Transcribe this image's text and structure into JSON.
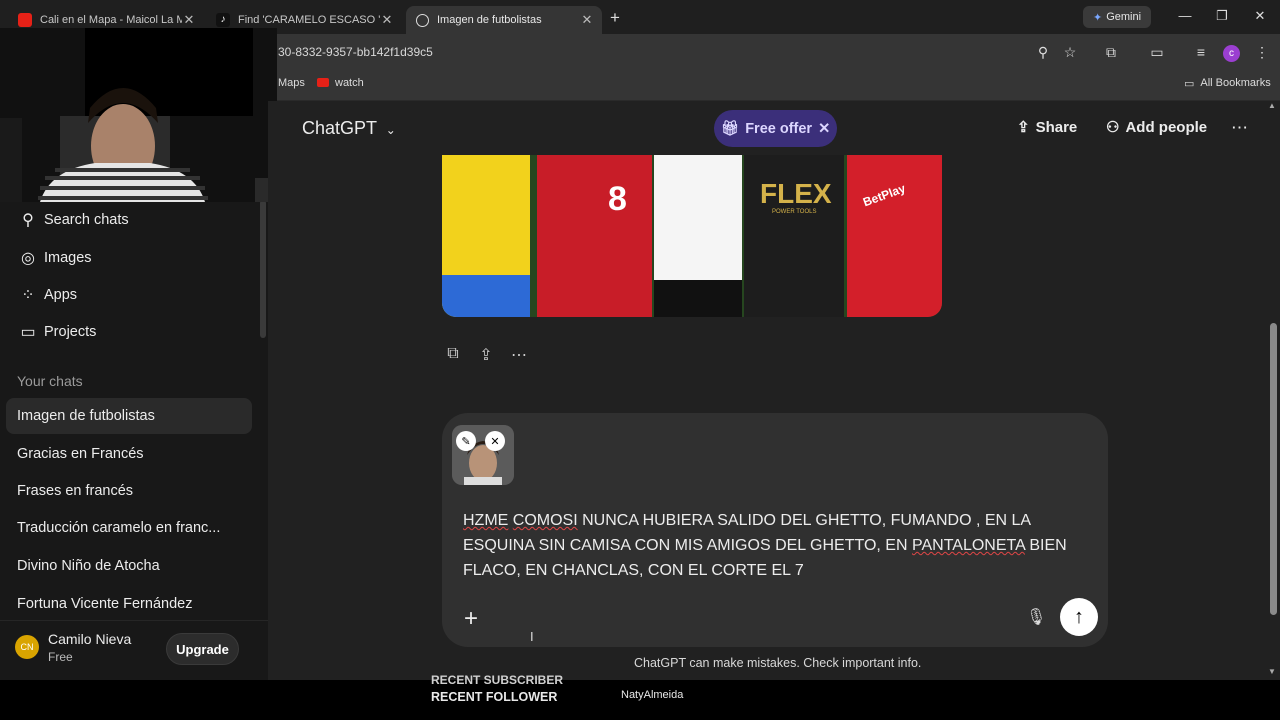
{
  "browser": {
    "tabs": [
      {
        "label": "Cali en el Mapa - Maicol La M",
        "icon": "youtube-icon"
      },
      {
        "label": "Find 'CARAMELO ESCASO ' on",
        "icon": "tiktok-icon"
      },
      {
        "label": "Imagen de futbolistas",
        "icon": "chatgpt-icon"
      }
    ],
    "new_tab": "+",
    "gemini_label": "Gemini",
    "url": "30-8332-9357-bb142f1d39c5",
    "profile_initial": "c",
    "bookmarks": [
      {
        "label": "Maps"
      },
      {
        "label": "watch"
      }
    ],
    "all_bookmarks": "All Bookmarks"
  },
  "sidebar": {
    "nav": [
      {
        "label": "Search chats",
        "icon": "search-icon"
      },
      {
        "label": "Images",
        "icon": "images-icon"
      },
      {
        "label": "Apps",
        "icon": "apps-icon"
      },
      {
        "label": "Projects",
        "icon": "projects-icon"
      }
    ],
    "section_title": "Your chats",
    "chats": [
      "Imagen de futbolistas",
      "Gracias en Francés",
      "Frases en francés",
      "Traducción caramelo en franc...",
      "Divino Niño de Atocha",
      "Fortuna Vicente Fernández"
    ],
    "user": {
      "initials": "CN",
      "name": "Camilo Nieva",
      "plan": "Free",
      "upgrade": "Upgrade"
    }
  },
  "header": {
    "title": "ChatGPT",
    "offer": "Free offer",
    "share": "Share",
    "add_people": "Add people"
  },
  "image": {
    "jersey_number": "8",
    "sponsor": "FLEX",
    "sponsor_sub": "POWER TOOLS",
    "sponsor2": "BetPlay"
  },
  "composer": {
    "prompt_parts": [
      {
        "text": "HZME",
        "spell": true
      },
      {
        "text": " ",
        "spell": false
      },
      {
        "text": "COMOSI",
        "spell": true
      },
      {
        "text": " NUNCA HUBIERA SALIDO DEL GHETTO, FUMANDO , EN LA ESQUINA SIN CAMISA CON MIS AMIGOS DEL GHETTO, EN ",
        "spell": false
      },
      {
        "text": "PANTALONETA",
        "spell": true
      },
      {
        "text": " BIEN FLACO, EN CHANCLAS, CON EL CORTE EL 7",
        "spell": false
      }
    ]
  },
  "disclaimer": "ChatGPT can make mistakes. Check important info.",
  "stream_overlay": {
    "recent_subscriber": "RECENT SUBSCRIBER",
    "recent_follower": "RECENT FOLLOWER",
    "follower_name": "NatyAlmeida"
  },
  "colors": {
    "accent_offer": "#3b2f7a",
    "sidebar_bg": "#181818",
    "main_bg": "#212121",
    "composer_bg": "#303030"
  }
}
